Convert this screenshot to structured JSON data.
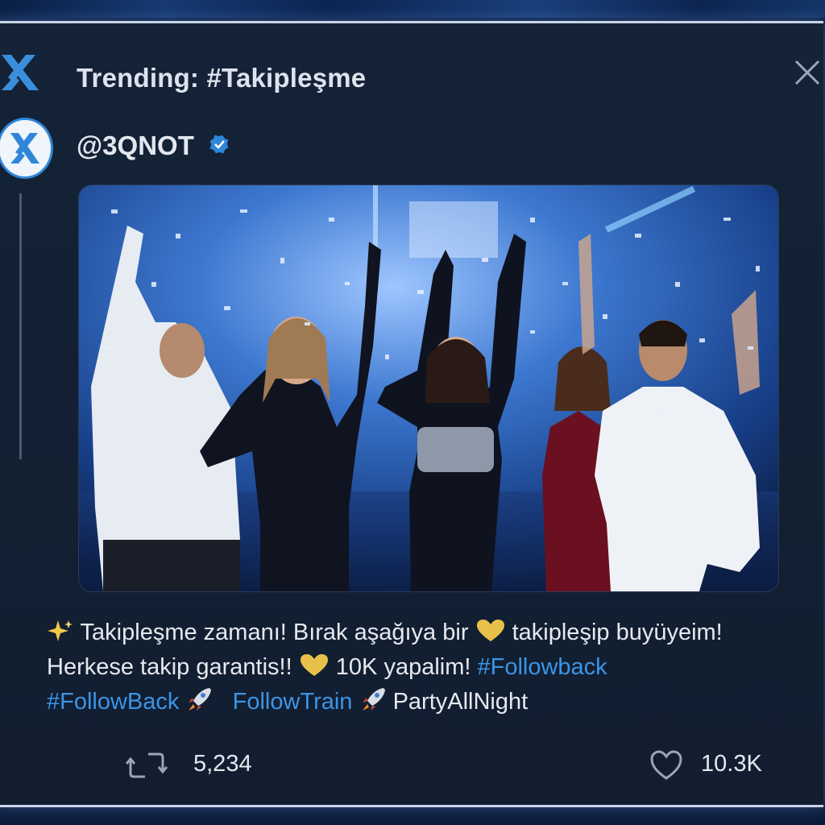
{
  "header": {
    "trending_title": "Trending: #Takipleşme",
    "logo_icon": "x-logo-icon",
    "close_icon": "close-icon"
  },
  "post": {
    "handle": "@3QNOT",
    "verified_icon": "verified-badge-icon",
    "image_alt": "Group of people celebrating at a party with confetti",
    "text_lines": {
      "line1_a": "Takipleşme zamanı! Bırak aşağıya bir",
      "line1_b": "takipleşip buyüyeim!",
      "line2_a": "Herkese takip garantis!!",
      "line2_b": "10K yapalim!",
      "line2_tag": "#Followback",
      "line3_tag1": "#FollowBack",
      "line3_tag2": "FollowTrain",
      "line3_c": "PartyAllNight"
    },
    "emojis": [
      "sparkles-icon",
      "yellow-heart-icon",
      "rocket-icon"
    ]
  },
  "actions": {
    "retweet_count": "5,234",
    "like_count": "10.3K"
  },
  "colors": {
    "accent": "#3b95e6",
    "card_bg": "#142338",
    "text": "#e6e9ee",
    "heart_yellow": "#e8c14a"
  }
}
